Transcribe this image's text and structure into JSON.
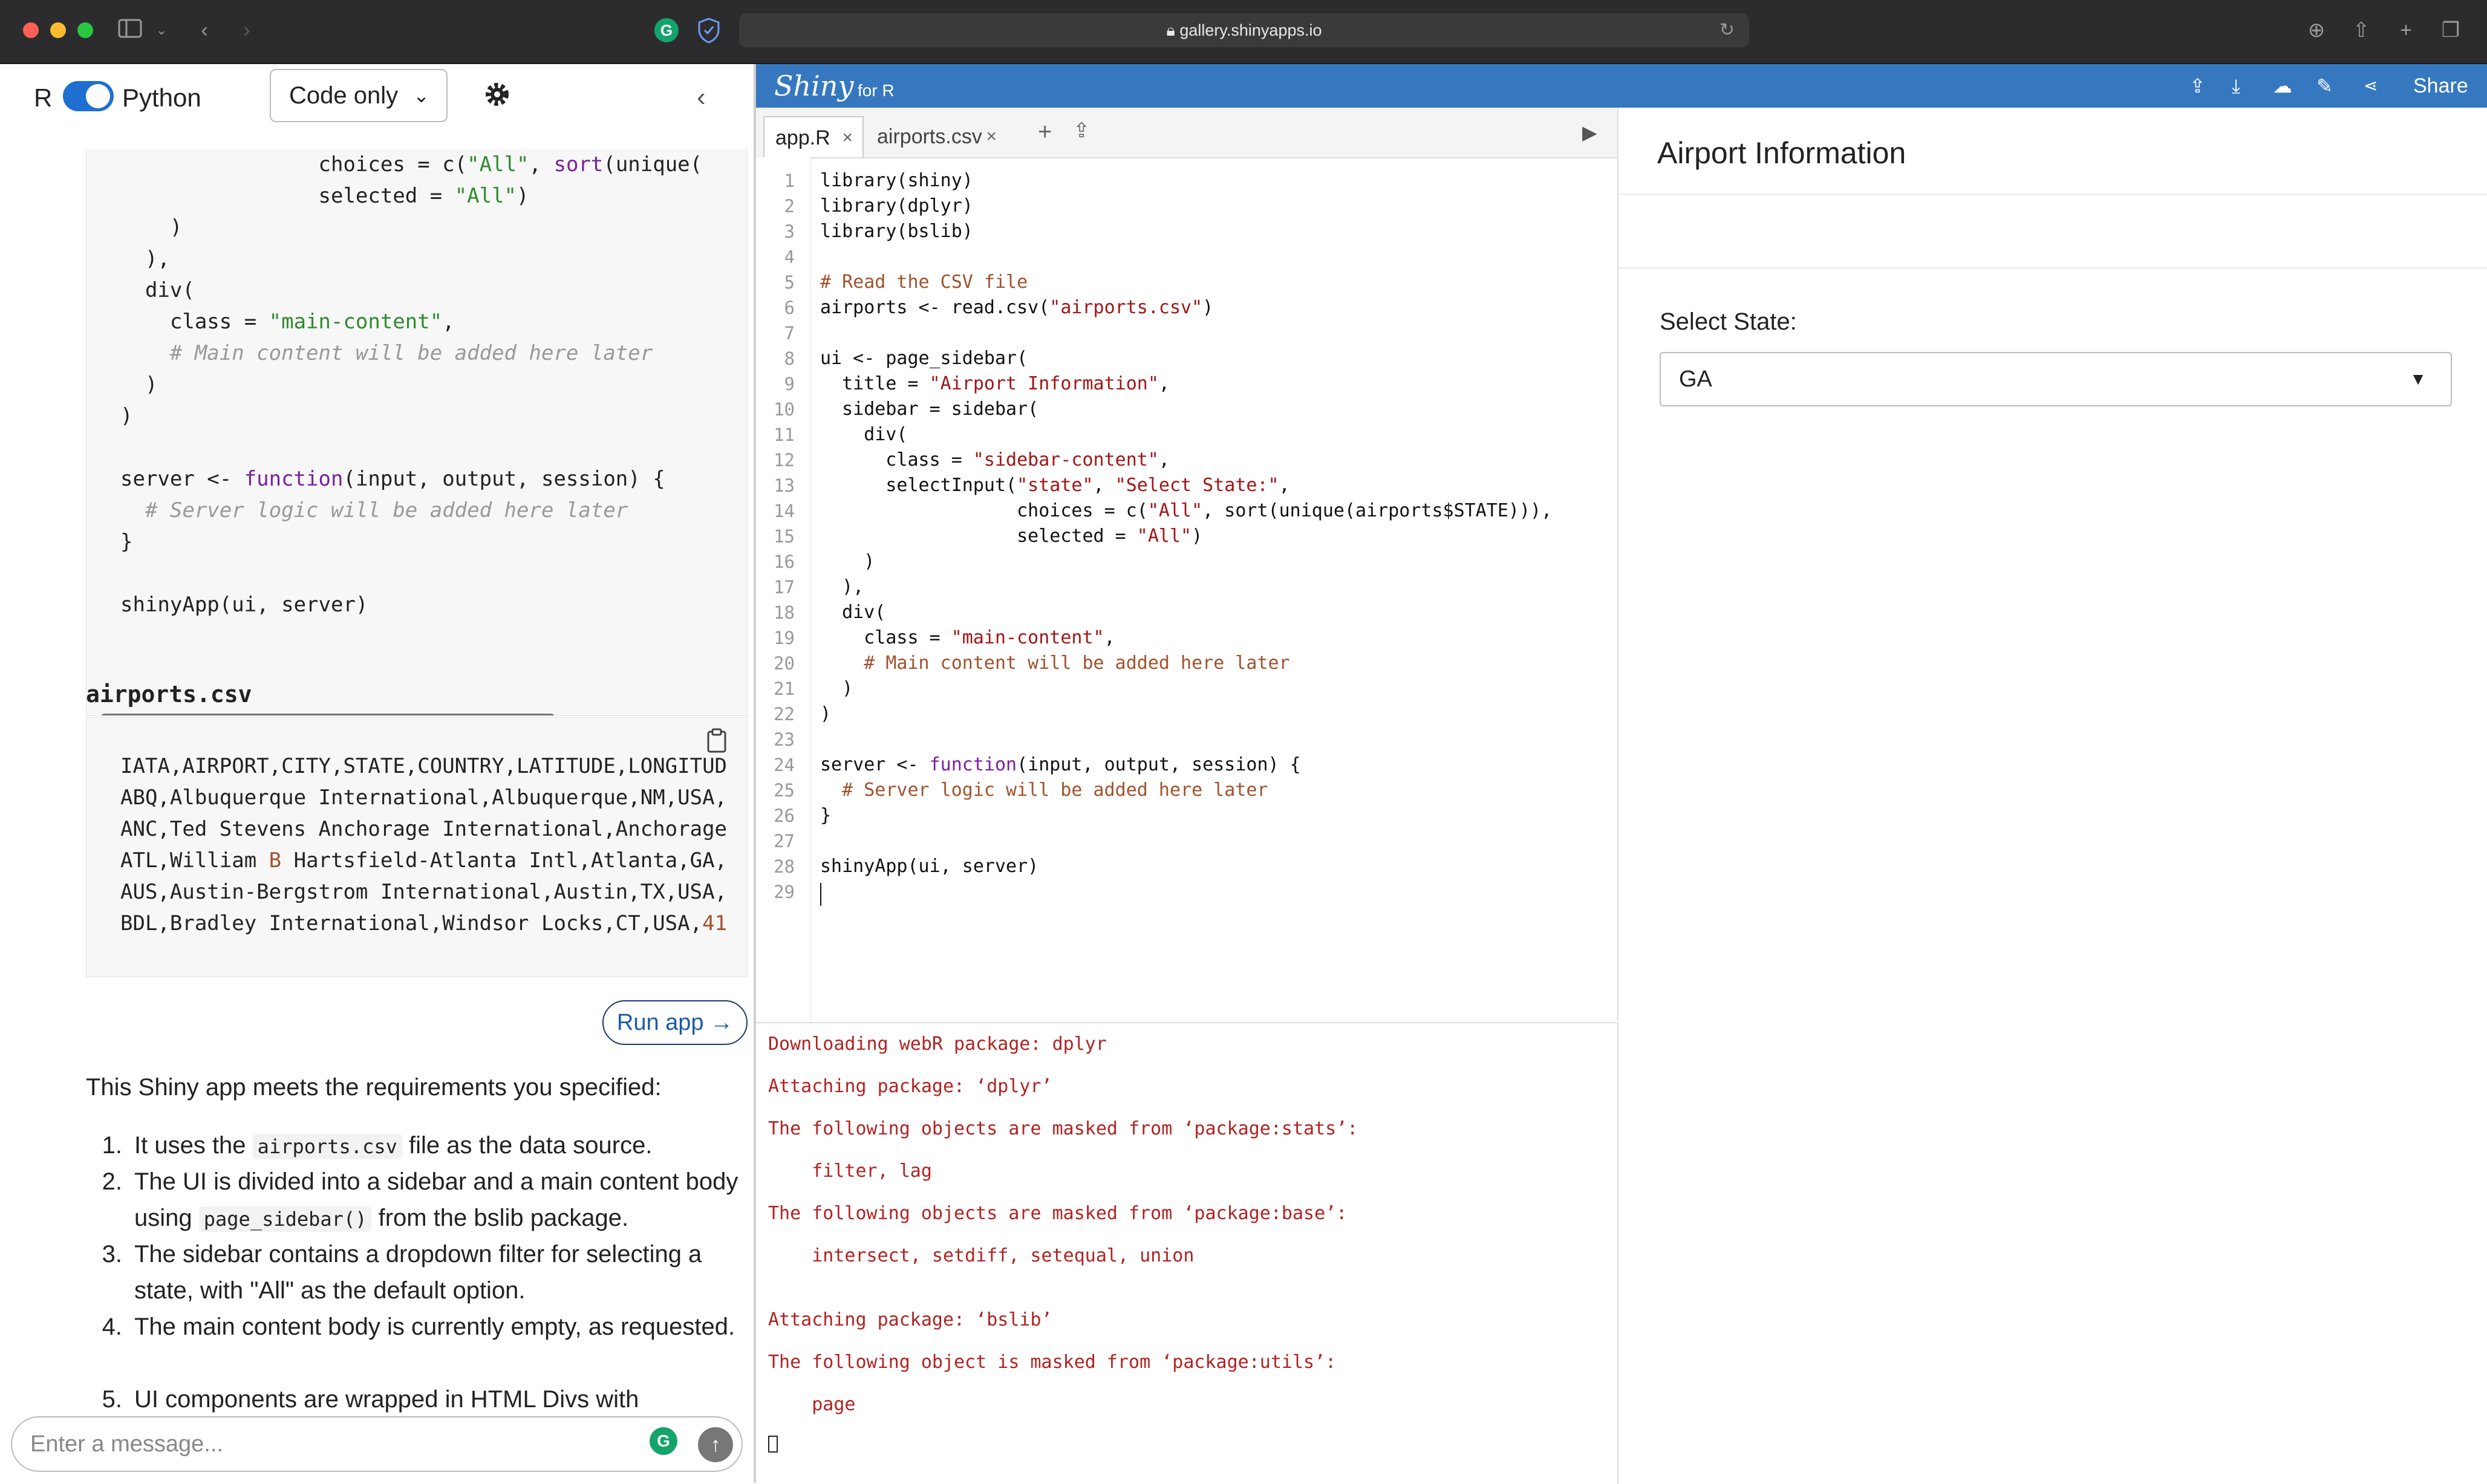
{
  "browser": {
    "url": "gallery.shinyapps.io"
  },
  "left_panel": {
    "lang_r": "R",
    "lang_python": "Python",
    "mode_select": "Code only",
    "code_lines": [
      "                choices = c(\"All\", sort(unique(",
      "                selected = \"All\")",
      "    )",
      "  ),",
      "  div(",
      "    class = \"main-content\",",
      "    # Main content will be added here later",
      "  )",
      ")",
      "",
      "server <- function(input, output, session) {",
      "  # Server logic will be added here later",
      "}",
      "",
      "shinyApp(ui, server)"
    ],
    "csv_title": "airports.csv",
    "csv_lines": [
      "IATA,AIRPORT,CITY,STATE,COUNTRY,LATITUDE,LONGITUD",
      "ABQ,Albuquerque International,Albuquerque,NM,USA,",
      "ANC,Ted Stevens Anchorage International,Anchorage",
      "ATL,William B Hartsfield-Atlanta Intl,Atlanta,GA,",
      "AUS,Austin-Bergstrom International,Austin,TX,USA,",
      "BDL,Bradley International,Windsor Locks,CT,USA,41"
    ],
    "run_app": "Run app →",
    "summary": "This Shiny app meets the requirements you specified:",
    "list": [
      {
        "num": "1.",
        "pre": "It uses the ",
        "code": "airports.csv",
        "post": " file as the data source."
      },
      {
        "num": "2.",
        "pre": "The UI is divided into a sidebar and a main content body using ",
        "code": "page_sidebar()",
        "post": " from the bslib package."
      },
      {
        "num": "3.",
        "pre": "The sidebar contains a dropdown filter for selecting a state, with \"All\" as the default option.",
        "code": "",
        "post": ""
      },
      {
        "num": "4.",
        "pre": "The main content body is currently empty, as requested.",
        "code": "",
        "post": ""
      },
      {
        "num": "5.",
        "pre": "UI components are wrapped in HTML Divs with",
        "code": "",
        "post": ""
      }
    ],
    "message_placeholder": "Enter a message..."
  },
  "shiny_bar": {
    "logo": "Shiny",
    "for": "for R",
    "share": "Share"
  },
  "editor": {
    "tabs": [
      {
        "label": "app.R"
      },
      {
        "label": "airports.csv"
      }
    ],
    "line_numbers": [
      "1",
      "2",
      "3",
      "4",
      "5",
      "6",
      "7",
      "8",
      "9",
      "10",
      "11",
      "12",
      "13",
      "14",
      "15",
      "16",
      "17",
      "18",
      "19",
      "20",
      "21",
      "22",
      "23",
      "24",
      "25",
      "26",
      "27",
      "28",
      "29"
    ]
  },
  "console": {
    "lines": [
      "Downloading webR package: dplyr",
      "Attaching package: ‘dplyr’",
      "The following objects are masked from ‘package:stats’:",
      "    filter, lag",
      "The following objects are masked from ‘package:base’:",
      "    intersect, setdiff, setequal, union",
      "Attaching package: ‘bslib’",
      "The following object is masked from ‘package:utils’:",
      "    page"
    ]
  },
  "preview": {
    "title": "Airport Information",
    "select_label": "Select State:",
    "select_value": "GA"
  },
  "colors": {
    "shiny_blue": "#3678c0",
    "console_red": "#b22222",
    "toggle_blue": "#1f6fd1"
  }
}
